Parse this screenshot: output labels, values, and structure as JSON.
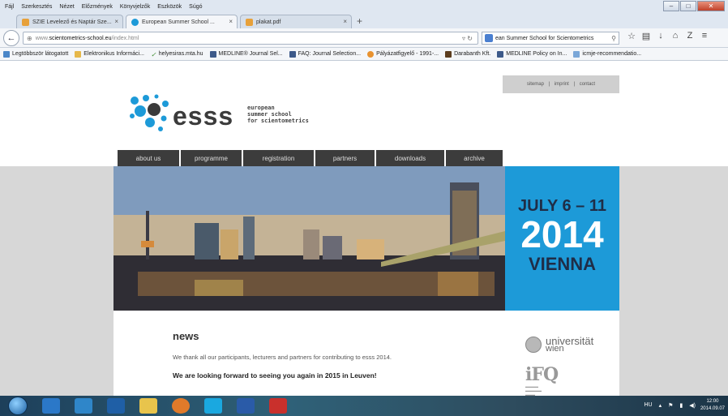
{
  "menu": [
    "Fájl",
    "Szerkesztés",
    "Nézet",
    "Előzmények",
    "Könyvjelzők",
    "Eszközök",
    "Súgó"
  ],
  "tabs": [
    {
      "label": "SZIE Levelező és Naptár Sze..."
    },
    {
      "label": "European Summer School ..."
    },
    {
      "label": "plakat.pdf"
    }
  ],
  "url": {
    "prefix": "www.",
    "domain": "scientometrics-school.eu",
    "path": "/index.html"
  },
  "search": {
    "value": "ean Summer School for Scientometrics"
  },
  "bookmarks": [
    "Legtöbbször látogatott",
    "Elektronikus Informáci...",
    "helyesiras.mta.hu",
    "MEDLINE® Journal Sel...",
    "FAQ: Journal Selection...",
    "Pályázatfigyelő - 1991-...",
    "Darabanth Kft.",
    "MEDLINE Policy on In...",
    "icmje-recommendatio..."
  ],
  "utility_links": {
    "sitemap": "sitemap",
    "imprint": "imprint",
    "contact": "contact",
    "sep": "|"
  },
  "logo": {
    "word": "esss",
    "sub1": "european",
    "sub2": "summer school",
    "sub3": "for scientometrics"
  },
  "nav": [
    "about us",
    "programme",
    "registration",
    "partners",
    "downloads",
    "archive"
  ],
  "date_box": {
    "dates": "JULY 6 – 11",
    "year": "2014",
    "city": "VIENNA"
  },
  "news": {
    "title": "news",
    "p1": "We thank all our participants, lecturers and partners for contributing to esss 2014.",
    "p2": "We are looking forward to seeing you again in 2015 in Leuven!"
  },
  "partners": {
    "uni1": "universität",
    "uni2": "wien",
    "ifq": "iFQ"
  },
  "taskbar": {
    "lang": "HU",
    "time": "12:00",
    "date": "2014.09.07"
  },
  "colors": {
    "date_box": "#1d9ad8",
    "nav_bg": "#3c3c3c",
    "logo_dot": "#1d9ad8"
  }
}
